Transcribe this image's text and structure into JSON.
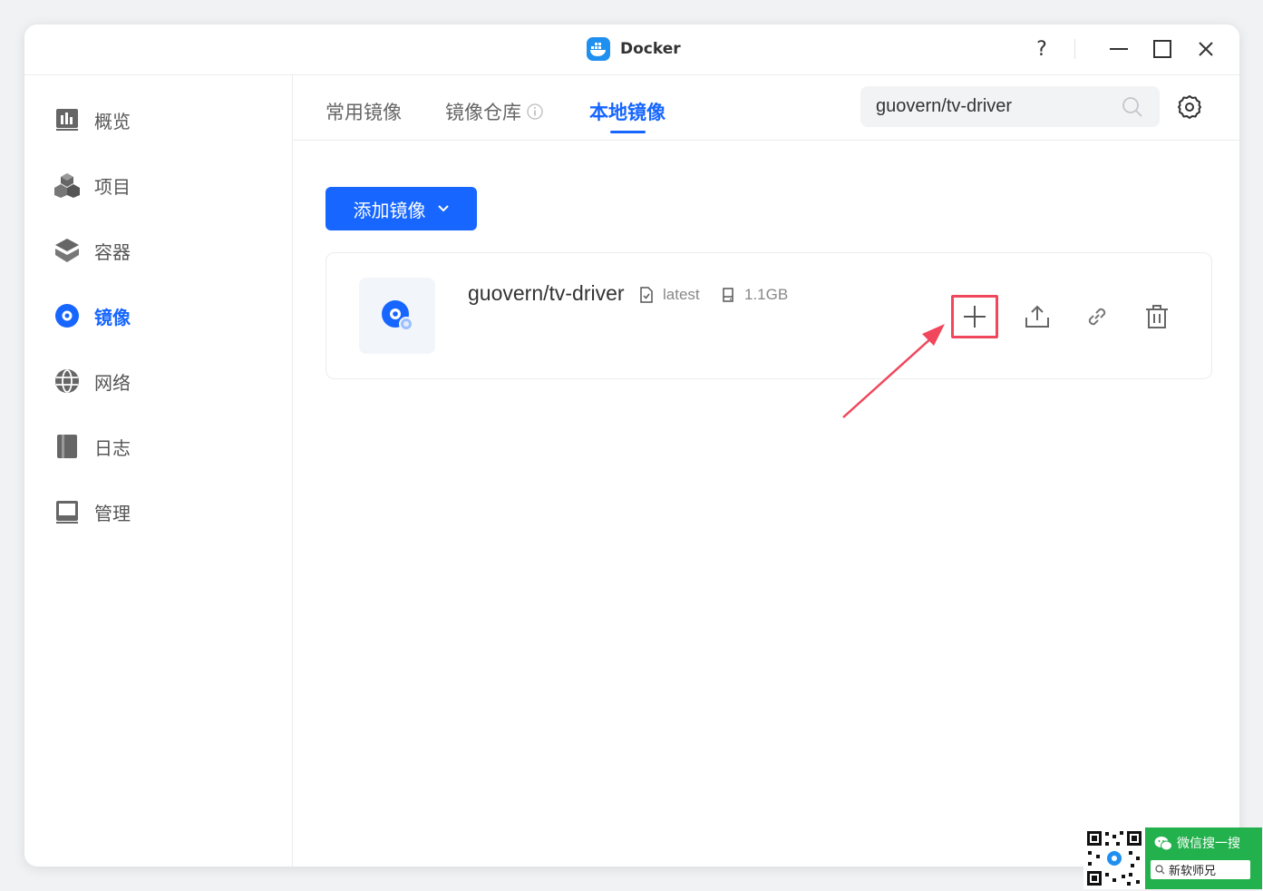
{
  "window": {
    "title": "Docker",
    "help_label": "?"
  },
  "sidebar": {
    "items": [
      {
        "label": "概览",
        "icon": "chart-icon",
        "active": false
      },
      {
        "label": "项目",
        "icon": "cubes-icon",
        "active": false
      },
      {
        "label": "容器",
        "icon": "layers-icon",
        "active": false
      },
      {
        "label": "镜像",
        "icon": "disc-icon",
        "active": true
      },
      {
        "label": "网络",
        "icon": "globe-icon",
        "active": false
      },
      {
        "label": "日志",
        "icon": "book-icon",
        "active": false
      },
      {
        "label": "管理",
        "icon": "monitor-icon",
        "active": false
      }
    ]
  },
  "tabs": [
    {
      "label": "常用镜像",
      "active": false
    },
    {
      "label": "镜像仓库",
      "active": false
    },
    {
      "label": "本地镜像",
      "active": true
    }
  ],
  "search": {
    "value": "guovern/tv-driver"
  },
  "toolbar": {
    "add_image_label": "添加镜像"
  },
  "images": [
    {
      "name": "guovern/tv-driver",
      "tag": "latest",
      "size": "1.1GB"
    }
  ],
  "colors": {
    "accent": "#1666ff",
    "highlight": "#f0475c",
    "wechat_green": "#22b14c"
  },
  "wechat_badge": {
    "top_text": "微信搜一搜",
    "search_text": "新软师兄"
  }
}
